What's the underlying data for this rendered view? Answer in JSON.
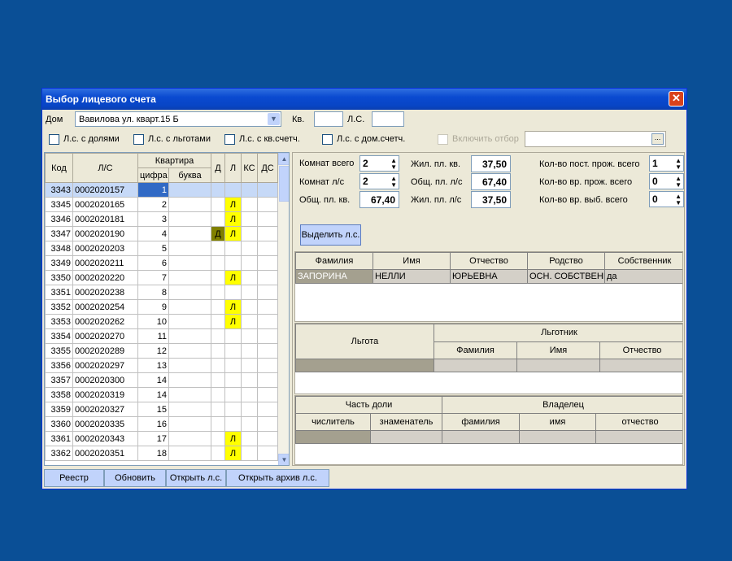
{
  "window": {
    "title": "Выбор лицевого счета",
    "close_glyph": "✕"
  },
  "filters": {
    "house_label": "Дом",
    "house_value": "Вавилова ул. кварт.15 Б",
    "apt_label": "Кв.",
    "ls_label": "Л.С.",
    "cb1": "Л.с. с долями",
    "cb2": "Л.с. с льготами",
    "cb3": "Л.с. с кв.счетч.",
    "cb4": "Л.с. с дом.счетч.",
    "cb5": "Включить отбор",
    "ellipsis": "..."
  },
  "grid": {
    "headers": {
      "kod": "Код",
      "ls": "Л/С",
      "kvartira": "Квартира",
      "cifra": "цифра",
      "bukva": "буква",
      "d": "Д",
      "l": "Л",
      "ks": "КС",
      "ds": "ДС"
    },
    "rows": [
      {
        "kod": "3343",
        "ls": "0002020157",
        "cifra": "1",
        "d": "",
        "l": ""
      },
      {
        "kod": "3345",
        "ls": "0002020165",
        "cifra": "2",
        "d": "",
        "l": "Л"
      },
      {
        "kod": "3346",
        "ls": "0002020181",
        "cifra": "3",
        "d": "",
        "l": "Л"
      },
      {
        "kod": "3347",
        "ls": "0002020190",
        "cifra": "4",
        "d": "Д",
        "l": "Л"
      },
      {
        "kod": "3348",
        "ls": "0002020203",
        "cifra": "5",
        "d": "",
        "l": ""
      },
      {
        "kod": "3349",
        "ls": "0002020211",
        "cifra": "6",
        "d": "",
        "l": ""
      },
      {
        "kod": "3350",
        "ls": "0002020220",
        "cifra": "7",
        "d": "",
        "l": "Л"
      },
      {
        "kod": "3351",
        "ls": "0002020238",
        "cifra": "8",
        "d": "",
        "l": ""
      },
      {
        "kod": "3352",
        "ls": "0002020254",
        "cifra": "9",
        "d": "",
        "l": "Л"
      },
      {
        "kod": "3353",
        "ls": "0002020262",
        "cifra": "10",
        "d": "",
        "l": "Л"
      },
      {
        "kod": "3354",
        "ls": "0002020270",
        "cifra": "11",
        "d": "",
        "l": ""
      },
      {
        "kod": "3355",
        "ls": "0002020289",
        "cifra": "12",
        "d": "",
        "l": ""
      },
      {
        "kod": "3356",
        "ls": "0002020297",
        "cifra": "13",
        "d": "",
        "l": ""
      },
      {
        "kod": "3357",
        "ls": "0002020300",
        "cifra": "14",
        "d": "",
        "l": ""
      },
      {
        "kod": "3358",
        "ls": "0002020319",
        "cifra": "14",
        "d": "",
        "l": ""
      },
      {
        "kod": "3359",
        "ls": "0002020327",
        "cifra": "15",
        "d": "",
        "l": ""
      },
      {
        "kod": "3360",
        "ls": "0002020335",
        "cifra": "16",
        "d": "",
        "l": ""
      },
      {
        "kod": "3361",
        "ls": "0002020343",
        "cifra": "17",
        "d": "",
        "l": "Л"
      },
      {
        "kod": "3362",
        "ls": "0002020351",
        "cifra": "18",
        "d": "",
        "l": "Л"
      }
    ]
  },
  "info": {
    "rooms_total_label": "Комнат всего",
    "rooms_total": "2",
    "rooms_ls_label": "Комнат л/с",
    "rooms_ls": "2",
    "total_area_label": "Общ. пл. кв.",
    "total_area": "67,40",
    "living_area_kv_label": "Жил. пл. кв.",
    "living_area_kv": "37,50",
    "total_area_ls_label": "Общ. пл. л/с",
    "total_area_ls": "67,40",
    "living_area_ls_label": "Жил. пл. л/с",
    "living_area_ls": "37,50",
    "perm_label": "Кол-во пост. прож. всего",
    "perm": "1",
    "temp_label": "Кол-во вр. прож. всего",
    "temp": "0",
    "temp_out_label": "Кол-во вр. выб. всего",
    "temp_out": "0"
  },
  "select_button": "Выделить л.с.",
  "residents": {
    "headers": [
      "Фамилия",
      "Имя",
      "Отчество",
      "Родство",
      "Собственник"
    ],
    "row": [
      "ЗАПОРИНА",
      "НЕЛЛИ",
      "ЮРЬЕВНА",
      "ОСН. СОБСТВЕНН",
      "да"
    ]
  },
  "benefits": {
    "headers": {
      "lgota": "Льгота",
      "lgotnik": "Льготник",
      "fam": "Фамилия",
      "name": "Имя",
      "otch": "Отчество"
    }
  },
  "shares": {
    "headers": {
      "part": "Часть доли",
      "owner": "Владелец",
      "num": "числитель",
      "den": "знаменатель",
      "fam": "фамилия",
      "name": "имя",
      "otch": "отчество"
    }
  },
  "bottom_buttons": {
    "registry": "Реестр",
    "refresh": "Обновить",
    "open_ls": "Открыть л.с.",
    "open_archive": "Открыть архив л.с."
  }
}
